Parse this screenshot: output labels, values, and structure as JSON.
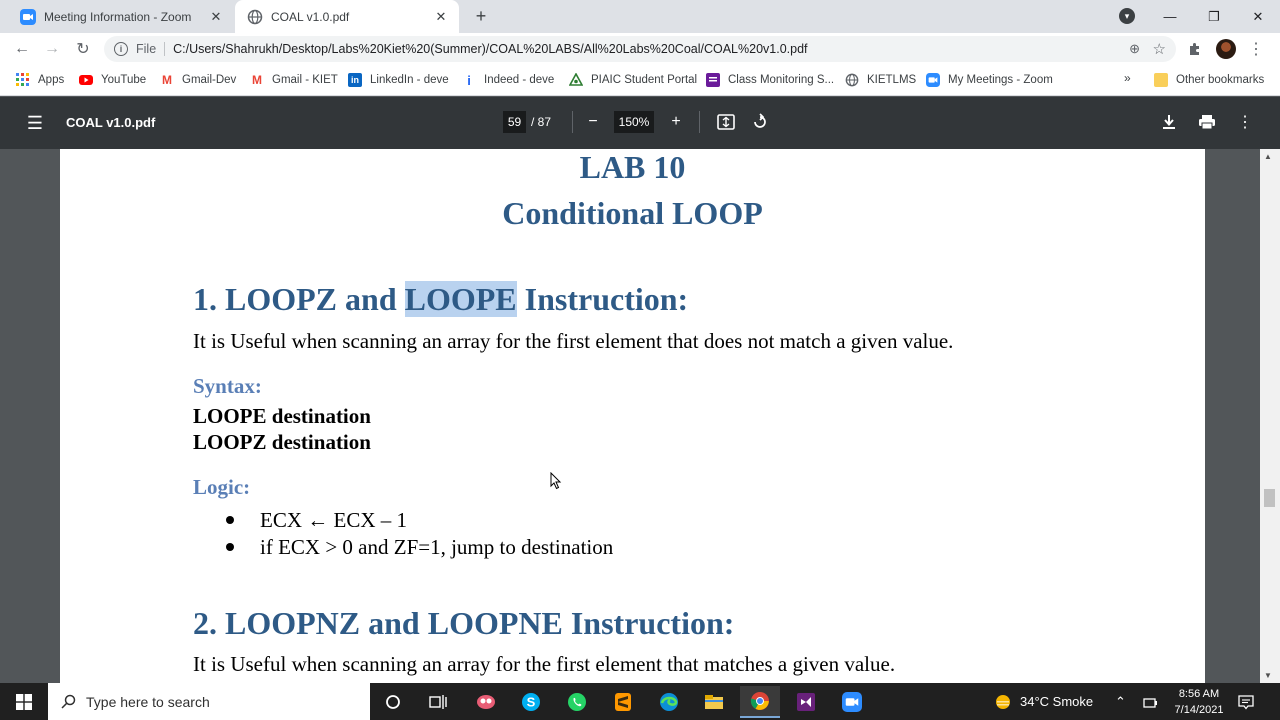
{
  "browser": {
    "tabs": [
      {
        "title": "Meeting Information - Zoom",
        "icon": "zoom-icon"
      },
      {
        "title": "COAL v1.0.pdf",
        "icon": "globe-icon"
      }
    ],
    "address": {
      "scheme": "File",
      "url": "C:/Users/Shahrukh/Desktop/Labs%20Kiet%20(Summer)/COAL%20LABS/All%20Labs%20Coal/COAL%20v1.0.pdf"
    },
    "bookmarks": [
      {
        "label": "Apps",
        "icon": "apps-grid-icon",
        "color": "#4285f4"
      },
      {
        "label": "YouTube",
        "icon": "youtube-icon",
        "color": "#ff0000"
      },
      {
        "label": "Gmail-Dev",
        "icon": "gmail-icon",
        "color": "#ea4335"
      },
      {
        "label": "Gmail - KIET",
        "icon": "gmail-icon",
        "color": "#ea4335"
      },
      {
        "label": "LinkedIn - deve",
        "icon": "linkedin-icon",
        "color": "#0a66c2"
      },
      {
        "label": "Indeed - deve",
        "icon": "indeed-icon",
        "color": "#2164f3"
      },
      {
        "label": "PIAIC Student Portal",
        "icon": "piaic-icon",
        "color": "#2e7d32"
      },
      {
        "label": "Class Monitoring S...",
        "icon": "class-monitor-icon",
        "color": "#6a1b9a"
      },
      {
        "label": "KIETLMS",
        "icon": "globe-icon",
        "color": "#5f6368"
      },
      {
        "label": "My Meetings - Zoom",
        "icon": "zoom-icon",
        "color": "#2d8cff"
      }
    ],
    "bookmarks_overflow": "»",
    "other_bookmarks": "Other bookmarks"
  },
  "pdf_toolbar": {
    "title": "COAL v1.0.pdf",
    "current_page": "59",
    "total_pages": "/ 87",
    "zoom": "150%"
  },
  "document": {
    "lab_number": "LAB 10",
    "lab_title": "Conditional LOOP",
    "section1": {
      "heading_prefix": "1. LOOPZ and ",
      "heading_highlight": "LOOPE",
      "heading_suffix": " Instruction:",
      "description": "It is Useful when scanning an array for the first element that does not match a given value.",
      "syntax_label": "Syntax:",
      "syntax_lines": [
        "LOOPE destination",
        "LOOPZ destination"
      ],
      "logic_label": "Logic:",
      "logic_items": [
        "ECX ← ECX – 1",
        "if ECX > 0 and ZF=1, jump to destination"
      ]
    },
    "section2": {
      "heading": "2. LOOPNZ and LOOPNE Instruction:",
      "description": "It is Useful when scanning an array for the first element that matches a given value."
    }
  },
  "taskbar": {
    "search_placeholder": "Type here to search",
    "weather": "34°C  Smoke",
    "time": "8:56 AM",
    "date": "7/14/2021"
  },
  "colors": {
    "heading_blue": "#2e5a86",
    "subheading_blue": "#5a7fb6",
    "highlight": "#b9d2ef"
  }
}
